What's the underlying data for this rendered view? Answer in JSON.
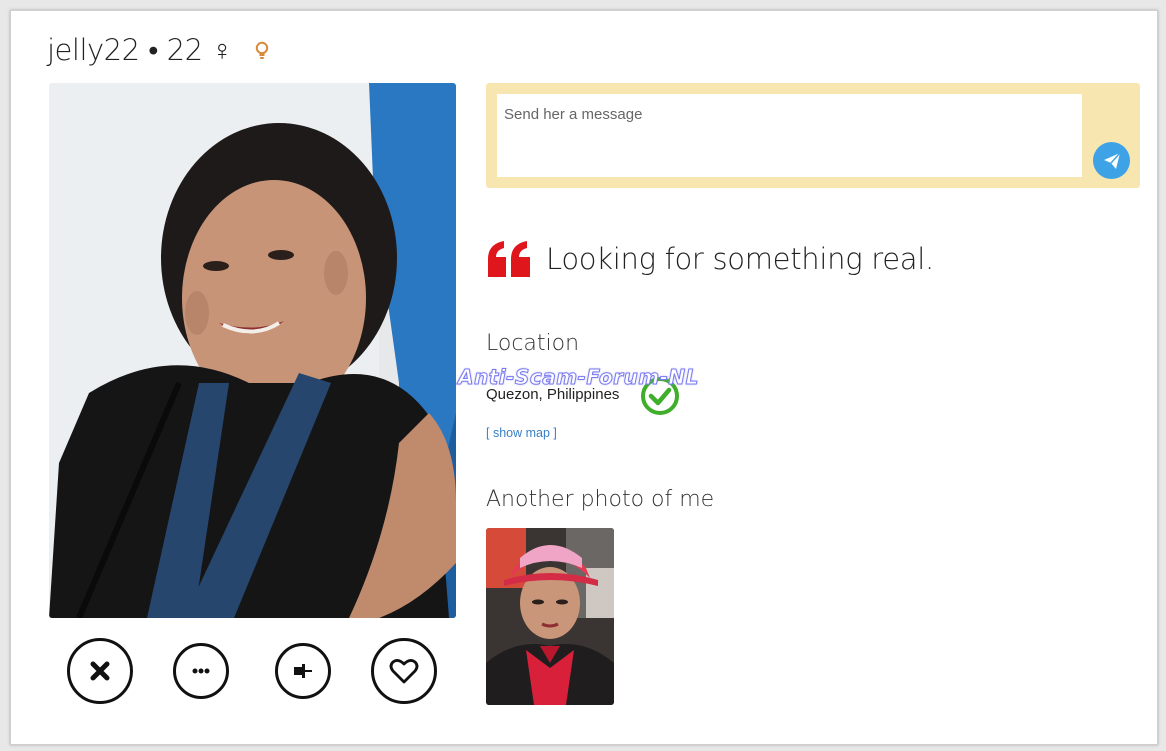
{
  "profile": {
    "title": "jelly22 • 22 ♀",
    "tagline": "Looking for something real."
  },
  "message": {
    "placeholder": "Send her a message"
  },
  "location": {
    "heading": "Location",
    "value": "Quezon, Philippines",
    "show_map_label": "[ show map ]",
    "verified_icon": "check-circle-icon"
  },
  "photos": {
    "heading": "Another photo of me"
  },
  "actions": [
    {
      "icon": "close-icon"
    },
    {
      "icon": "more-icon"
    },
    {
      "icon": "pin-icon"
    },
    {
      "icon": "heart-icon"
    }
  ],
  "watermark": {
    "text": "Anti-Scam-Forum-NL"
  },
  "colors": {
    "message_box_bg": "#f7e6b0",
    "send_button": "#3ea3e6",
    "quote_icon": "#e0161d",
    "verified": "#3fae2a",
    "link": "#3a7fc4",
    "bulb": "#d9893a"
  }
}
